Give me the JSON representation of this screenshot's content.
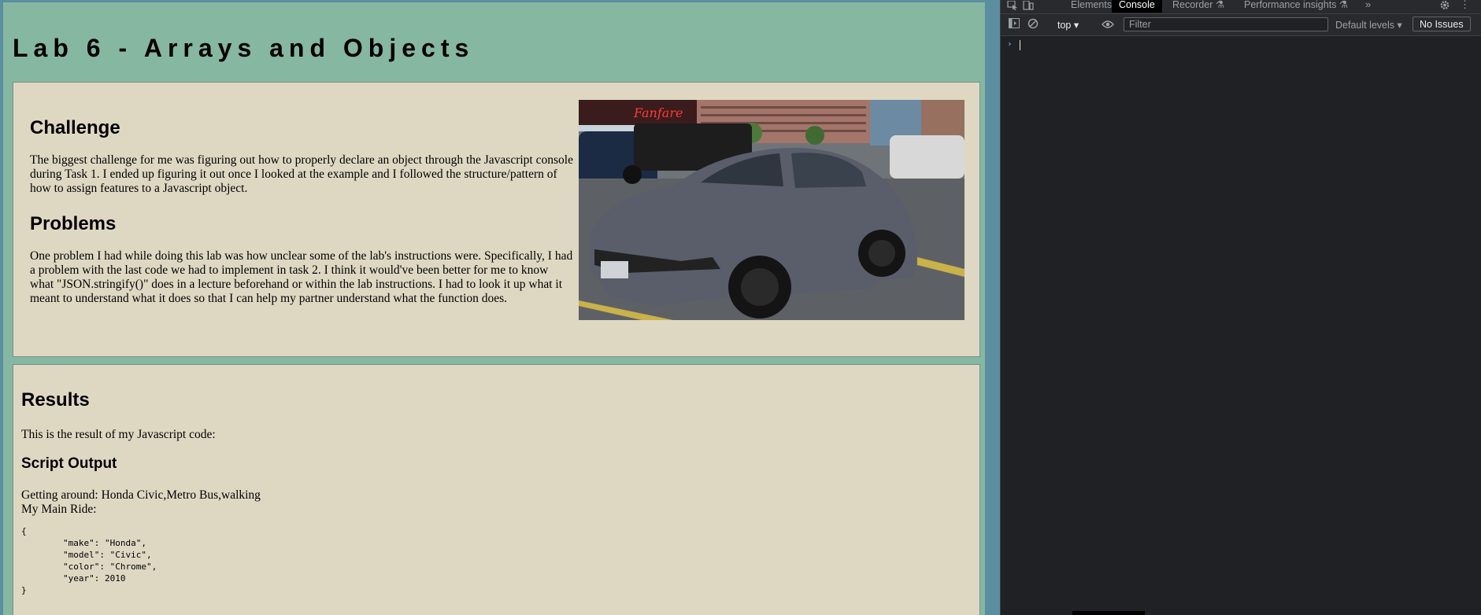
{
  "page": {
    "title": "Lab 6 - Arrays and Objects",
    "challenge": {
      "heading": "Challenge",
      "text": "The biggest challenge for me was figuring out how to properly declare an object through the Javascript console during Task 1. I ended up figuring it out once I looked at the example and I followed the structure/pattern of how to assign features to a Javascript object."
    },
    "problems": {
      "heading": "Problems",
      "text": "One problem I had while doing this lab was how unclear some of the lab's instructions were. Specifically, I had a problem with the last code we had to implement in task 2. I think it would've been better for me to know what \"JSON.stringify()\" does in a lecture beforehand or within the lab instructions. I had to look it up what it meant to understand what it does so that I can help my partner understand what the function does."
    },
    "image": {
      "subject": "grey Honda Civic coupe in parking lot",
      "sign_text": "Fanfare"
    },
    "results": {
      "heading": "Results",
      "intro": "This is the result of my Javascript code:",
      "script_output_heading": "Script Output",
      "getting_around": "Getting around: Honda Civic,Metro Bus,walking",
      "main_ride_label": "My Main Ride:",
      "json": "{\n\t\"make\": \"Honda\",\n\t\"model\": \"Civic\",\n\t\"color\": \"Chrome\",\n\t\"year\": 2010\n}"
    }
  },
  "devtools": {
    "tabs": [
      {
        "label": "Elements",
        "active": false
      },
      {
        "label": "Console",
        "active": true
      },
      {
        "label": "Recorder",
        "active": false
      },
      {
        "label": "Performance insights",
        "active": false
      }
    ],
    "more_tabs": "»",
    "kebab": "⋮",
    "context": "top ▾",
    "filter_placeholder": "Filter",
    "levels": "Default levels ▾",
    "issues": "No Issues",
    "prompt": "›",
    "icons": {
      "inspect": "inspect-element-icon",
      "device": "device-toolbar-icon",
      "sidebar": "console-sidebar-icon",
      "clear": "clear-console-icon",
      "eye": "live-expression-icon",
      "settings": "gear-icon",
      "flask": "experiment-flask-icon"
    },
    "colors": {
      "background": "#202124",
      "active_tab": "#000000",
      "accent": "#8ab4f8"
    }
  }
}
